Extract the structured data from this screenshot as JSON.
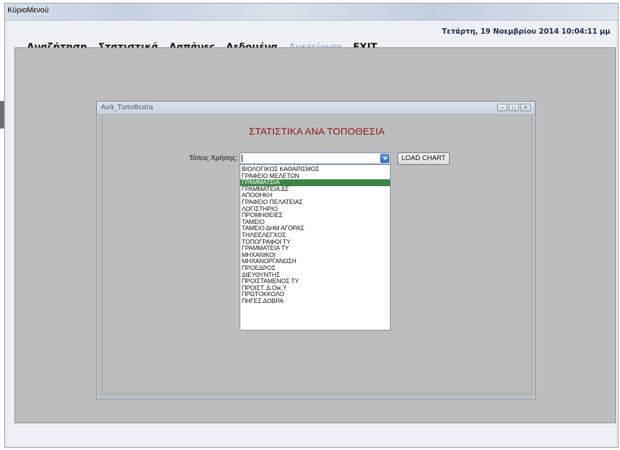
{
  "window": {
    "title": "ΚύριοΜενού"
  },
  "header": {
    "datetime": "Τετάρτη, 19 Νοεμβρίου 2014 10:04:11 μμ"
  },
  "menu": {
    "items": [
      {
        "label": "Αναζήτηση",
        "enabled": true
      },
      {
        "label": "Στατιστικά",
        "enabled": true
      },
      {
        "label": "Δαπάνες",
        "enabled": true
      },
      {
        "label": "Δεδομένα",
        "enabled": true
      },
      {
        "label": "Διαχείριση",
        "enabled": false
      },
      {
        "label": "EXIT",
        "enabled": true
      }
    ]
  },
  "child_window": {
    "title": "Ανά_Τοποθεσία",
    "heading": "ΣΤΑΤΙΣΤΙΚΑ ΑΝΑ ΤΟΠΟΘΕΣΙΑ",
    "location_label": "Τόπος Χρήσης:",
    "location_value": "",
    "load_button": "LOAD CHART",
    "dropdown_selected_index": 2,
    "dropdown_options": [
      "ΒΙΟΛΟΓΙΚΟΣ ΚΑΘΑΡΙΣΜΟΣ",
      "ΓΡΑΦΕΙΟ ΜΕΛΕΤΩΝ",
      "ΓΡΑΜΜΑΤΕΙΑ",
      "ΓΡΑΜΜΑΤΕΙΑ ΔΣ",
      "ΑΠΟΘΗΚΗ",
      "ΓΡΑΦΕΙΟ ΠΕΛΑΤΕΙΑΣ",
      "ΛΟΓΙΣΤΗΡΙΟ",
      "ΠΡΟΜΗΘΕΙΕΣ",
      "ΤΑΜΕΙΟ",
      "ΤΑΜΕΙΟ ΔΗΜ ΑΓΟΡΑΣ",
      "ΤΗΛΕΕΛΕΓΧΟΣ",
      "ΤΟΠΟΓΡΑΦΟΙ ΤΥ",
      "ΓΡΑΜΜΑΤΕΙΑ ΤΥ",
      "ΜΗΧΑΝΙΚΟΙ",
      "ΜΗΧΑΝΟΡΓΑΝΩΣΗ",
      "ΠΡΟΕΔΡΟΣ",
      "ΔΙΕΥΘΥΝΤΗΣ",
      "ΠΡΟΙΣΤΑΜΕΝΟΣ ΤΥ",
      "ΠΡΟΙΣΤ. Δ.Οικ.Υ",
      "ΠΡΩΤΟΚΚΟΛΟ",
      "ΠΗΓΕΣ ΔΟΒΡΑ"
    ]
  },
  "colors": {
    "heading": "#8b1111",
    "selected_item_bg": "#3d8447",
    "disabled_menu": "#7f9fbf"
  }
}
